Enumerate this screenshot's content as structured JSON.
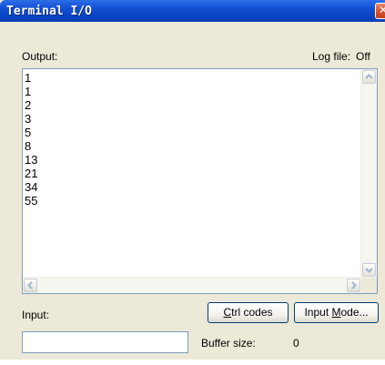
{
  "window": {
    "title": "Terminal I/O",
    "close_glyph": "✕"
  },
  "output": {
    "label": "Output:",
    "log_file_label": "Log file:",
    "log_file_value": "Off",
    "lines": [
      "1",
      "1",
      "2",
      "3",
      "5",
      "8",
      "13",
      "21",
      "34",
      "55"
    ]
  },
  "input": {
    "label": "Input:",
    "value": "",
    "placeholder": ""
  },
  "buttons": {
    "ctrl_codes": {
      "accel": "C",
      "rest": "trl codes"
    },
    "input_mode": {
      "pre": "Input ",
      "accel": "M",
      "rest": "ode..."
    }
  },
  "buffer": {
    "label": "Buffer size:",
    "value": "0"
  },
  "scroll_icons": {
    "up": "scroll-up-arrow",
    "down": "scroll-down-arrow",
    "left": "scroll-left-arrow",
    "right": "scroll-right-arrow"
  }
}
